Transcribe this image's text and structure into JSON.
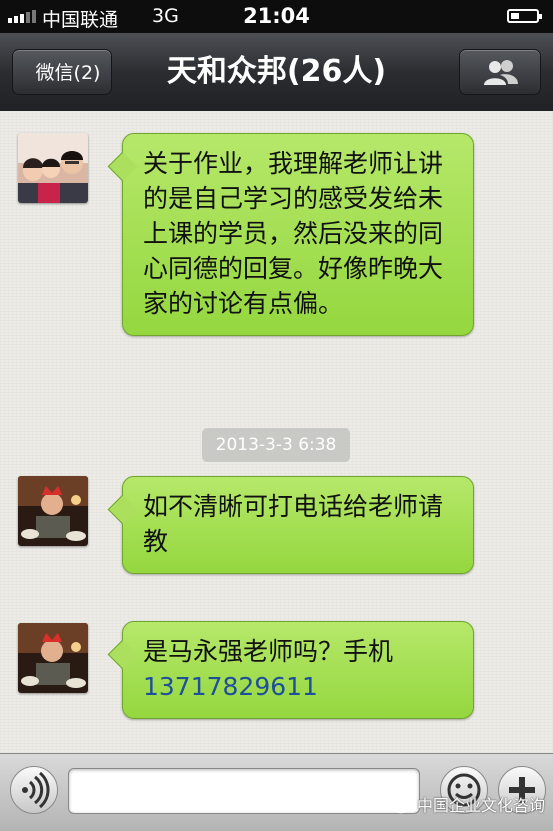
{
  "status_bar": {
    "carrier": "中国联通",
    "network": "3G",
    "time": "21:04"
  },
  "nav": {
    "back_label": "微信(2)",
    "title": "天和众邦(26人)",
    "members_icon": "members-icon"
  },
  "messages": [
    {
      "avatar": "group-photo-avatar",
      "text": "关于作业，我理解老师让讲的是自己学习的感受发给未上课的学员，然后没来的同心同德的回复。好像昨晚大家的讨论有点偏。"
    },
    {
      "avatar": "teacher-avatar",
      "text": "如不清晰可打电话给老师请教"
    },
    {
      "avatar": "teacher-avatar",
      "text": "是马永强老师吗？手机",
      "phone": "13717829611"
    }
  ],
  "timestamp": "2013-3-3 6:38",
  "input_bar": {
    "message_value": "",
    "voice_icon": "voice-icon",
    "emoji_icon": "emoji-icon",
    "more_icon": "plus-icon"
  },
  "watermark": "中国企业文化咨询",
  "colors": {
    "bubble": "#a6e05a",
    "nav": "#2b2d31",
    "link": "#1e4f9a"
  }
}
